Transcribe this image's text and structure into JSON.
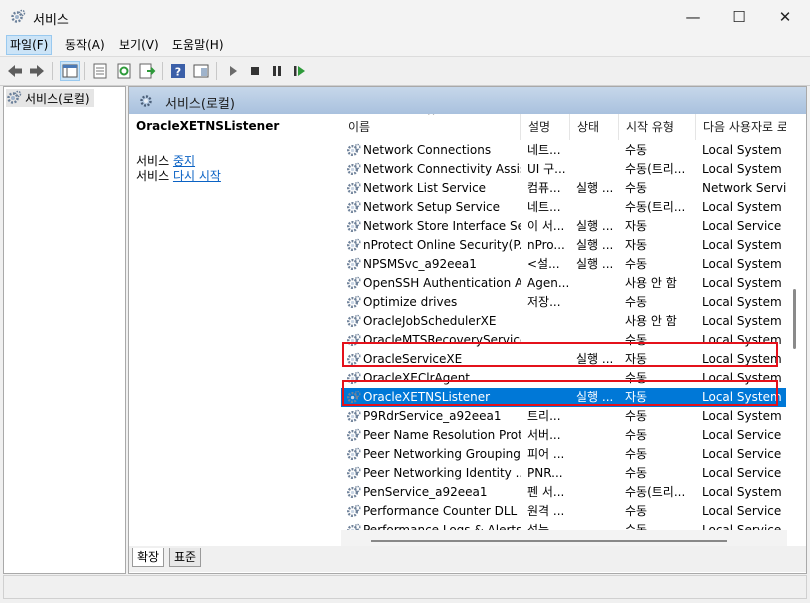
{
  "window": {
    "title": "서비스",
    "minimize": "—",
    "maximize": "☐",
    "close": "✕"
  },
  "menu": [
    "파일(F)",
    "동작(A)",
    "보기(V)",
    "도움말(H)"
  ],
  "tree": {
    "root_label": "서비스(로컬)"
  },
  "pane": {
    "header": "서비스(로컬)"
  },
  "detail": {
    "service_name": "OracleXETNSListener",
    "stop_prefix": "서비스",
    "stop_link": "중지",
    "restart_prefix": "서비스",
    "restart_link": "다시 시작"
  },
  "columns": [
    "이름",
    "설명",
    "상태",
    "시작 유형",
    "다음 사용자로 로"
  ],
  "rows": [
    {
      "name": "Network Connections",
      "desc": "네트...",
      "status": "",
      "startup": "수동",
      "logon": "Local System"
    },
    {
      "name": "Network Connectivity Assis...",
      "desc": "UI 구...",
      "status": "",
      "startup": "수동(트리...",
      "logon": "Local System"
    },
    {
      "name": "Network List Service",
      "desc": "컴퓨...",
      "status": "실행 ...",
      "startup": "수동",
      "logon": "Network Service"
    },
    {
      "name": "Network Setup Service",
      "desc": "네트...",
      "status": "",
      "startup": "수동(트리...",
      "logon": "Local System"
    },
    {
      "name": "Network Store Interface Se...",
      "desc": "이 서...",
      "status": "실행 ...",
      "startup": "자동",
      "logon": "Local Service"
    },
    {
      "name": "nProtect Online Security(P...",
      "desc": "nPro...",
      "status": "실행 ...",
      "startup": "자동",
      "logon": "Local System"
    },
    {
      "name": "NPSMSvc_a92eea1",
      "desc": "<설...",
      "status": "실행 ...",
      "startup": "수동",
      "logon": "Local System"
    },
    {
      "name": "OpenSSH Authentication A...",
      "desc": "Agen...",
      "status": "",
      "startup": "사용 안 함",
      "logon": "Local System"
    },
    {
      "name": "Optimize drives",
      "desc": "저장...",
      "status": "",
      "startup": "수동",
      "logon": "Local System"
    },
    {
      "name": "OracleJobSchedulerXE",
      "desc": "",
      "status": "",
      "startup": "사용 안 함",
      "logon": "Local System"
    },
    {
      "name": "OracleMTSRecoveryService",
      "desc": "",
      "status": "",
      "startup": "수동",
      "logon": "Local System"
    },
    {
      "name": "OracleServiceXE",
      "desc": "",
      "status": "실행 ...",
      "startup": "자동",
      "logon": "Local System"
    },
    {
      "name": "OracleXEClrAgent",
      "desc": "",
      "status": "",
      "startup": "수동",
      "logon": "Local System"
    },
    {
      "name": "OracleXETNSListener",
      "desc": "",
      "status": "실행 ...",
      "startup": "자동",
      "logon": "Local System"
    },
    {
      "name": "P9RdrService_a92eea1",
      "desc": "트리...",
      "status": "",
      "startup": "수동",
      "logon": "Local System"
    },
    {
      "name": "Peer Name Resolution Prot...",
      "desc": "서버...",
      "status": "",
      "startup": "수동",
      "logon": "Local Service"
    },
    {
      "name": "Peer Networking Grouping",
      "desc": "피어 ...",
      "status": "",
      "startup": "수동",
      "logon": "Local Service"
    },
    {
      "name": "Peer Networking Identity ...",
      "desc": "PNR...",
      "status": "",
      "startup": "수동",
      "logon": "Local Service"
    },
    {
      "name": "PenService_a92eea1",
      "desc": "펜 서...",
      "status": "",
      "startup": "수동(트리...",
      "logon": "Local System"
    },
    {
      "name": "Performance Counter DLL ...",
      "desc": "원격 ...",
      "status": "",
      "startup": "수동",
      "logon": "Local Service"
    },
    {
      "name": "Performance Logs & Alerts",
      "desc": "성능 ...",
      "status": "",
      "startup": "수동",
      "logon": "Local Service"
    }
  ],
  "selected_service": "OracleXETNSListener",
  "highlighted_services": [
    "OracleServiceXE",
    "OracleXETNSListener"
  ],
  "tabs": [
    "확장",
    "표준"
  ],
  "colors": {
    "selection": "#0078d7",
    "highlight_box": "#e4111b",
    "link": "#0b62c4"
  },
  "icons": [
    "services-icon",
    "back-arrow-icon",
    "forward-arrow-icon",
    "console-tree-icon",
    "properties-icon",
    "refresh-icon",
    "export-list-icon",
    "help-icon",
    "show-hide-icon",
    "play-icon",
    "stop-icon",
    "pause-icon",
    "restart-icon",
    "gear-icon"
  ]
}
